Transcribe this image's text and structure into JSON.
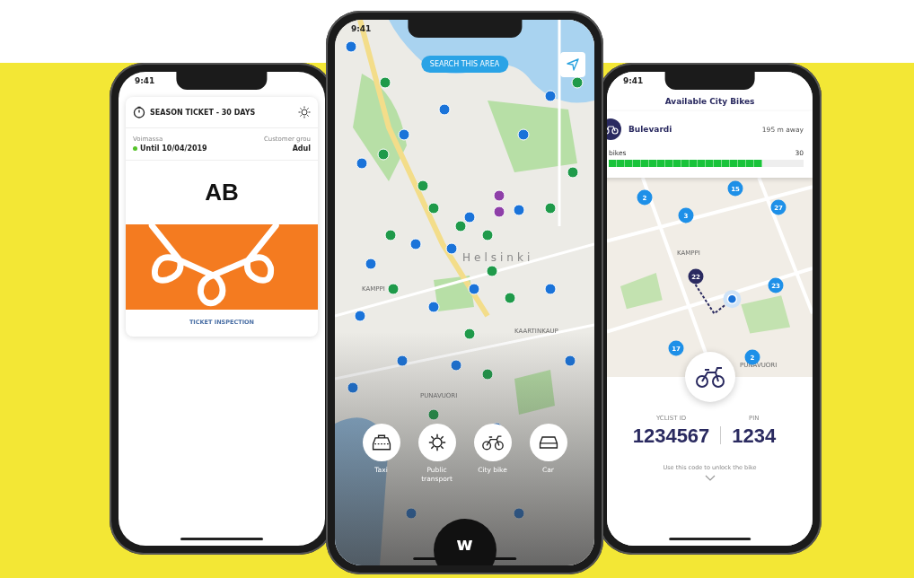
{
  "ticket_phone": {
    "status_time": "9:41",
    "title": "SEASON TICKET - 30 DAYS",
    "validity_label": "Voimassa",
    "validity_value": "Until 10/04/2019",
    "group_label": "Customer grou",
    "group_value": "Adul",
    "zone": "AB",
    "inspection_link": "TICKET INSPECTION"
  },
  "map_phone": {
    "status_time": "9:41",
    "search_button": "SEARCH THIS AREA",
    "map_labels": [
      "Helsinki",
      "KAMPPI",
      "KAARTINKAUP",
      "PUNAVUORI"
    ],
    "modes": [
      {
        "kind": "taxi",
        "label": "Taxi"
      },
      {
        "kind": "transport",
        "label": "Public transport"
      },
      {
        "kind": "bike",
        "label": "City bike"
      },
      {
        "kind": "car",
        "label": "Car"
      }
    ],
    "logo": "w"
  },
  "bike_phone": {
    "status_time": "9:41",
    "title": "Available City Bikes",
    "station": {
      "name": "Bulevardi",
      "distance": "195 m away",
      "bikes_label": "bikes",
      "capacity": "30",
      "level": 0.79
    },
    "pins": [
      "15",
      "2",
      "27",
      "3",
      "22",
      "23",
      "17",
      "2"
    ],
    "map_labels": [
      "KAMPPI",
      "PUNAVUORI"
    ],
    "id_label": "YCLIST ID",
    "id_value": "1234567",
    "pin_label": "PIN",
    "pin_value": "1234",
    "hint": "Use this code to unlock the bike"
  }
}
